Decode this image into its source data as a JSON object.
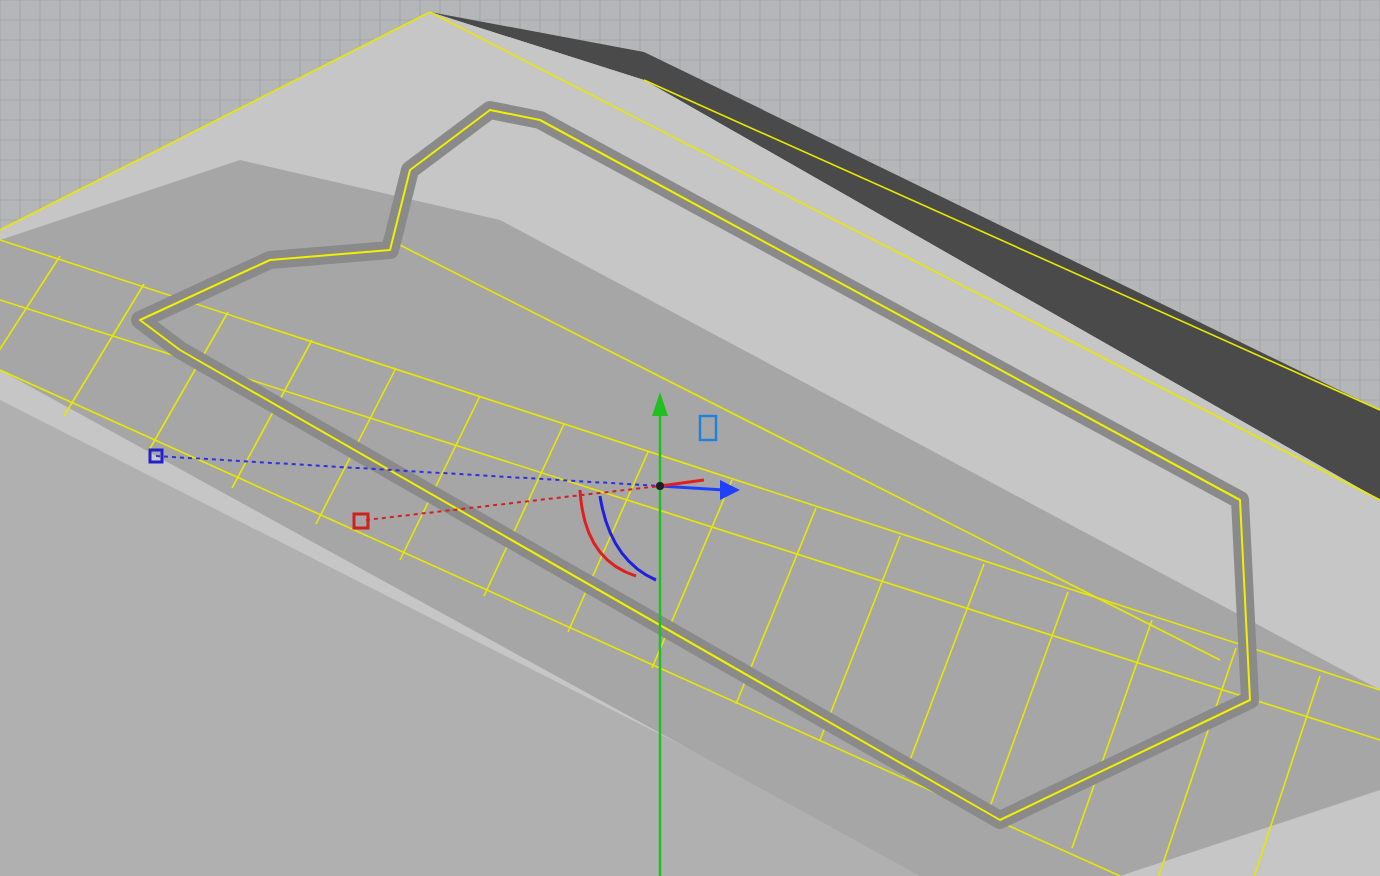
{
  "viewport": {
    "grid": true,
    "gumball": true
  }
}
